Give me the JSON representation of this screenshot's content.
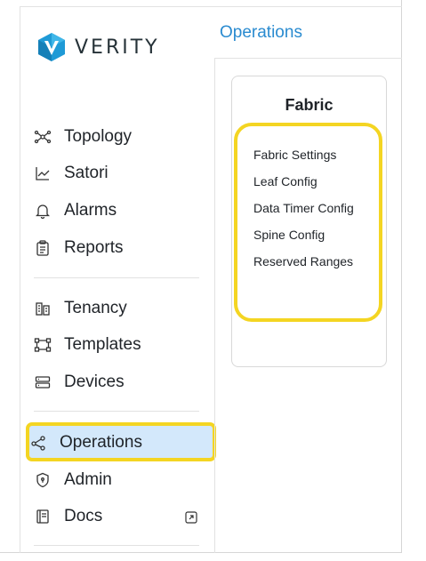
{
  "brand": {
    "logo_text": "VERITY"
  },
  "sidebar": {
    "items": [
      {
        "label": "Topology",
        "icon": "topology-icon"
      },
      {
        "label": "Satori",
        "icon": "chart-icon"
      },
      {
        "label": "Alarms",
        "icon": "bell-icon"
      },
      {
        "label": "Reports",
        "icon": "report-icon"
      },
      {
        "label": "Tenancy",
        "icon": "tenancy-icon"
      },
      {
        "label": "Templates",
        "icon": "templates-icon"
      },
      {
        "label": "Devices",
        "icon": "devices-icon"
      },
      {
        "label": "Operations",
        "icon": "operations-icon",
        "active": true
      },
      {
        "label": "Admin",
        "icon": "shield-icon"
      },
      {
        "label": "Docs",
        "icon": "book-icon",
        "external": true
      }
    ]
  },
  "main": {
    "title": "Operations",
    "card": {
      "title": "Fabric",
      "links": [
        "Fabric Settings",
        "Leaf Config",
        "Data Timer Config",
        "Spine Config",
        "Reserved Ranges"
      ]
    }
  },
  "colors": {
    "accent": "#2a8bd0",
    "highlight": "#f4d522",
    "active_bg": "#d3e8fb"
  }
}
